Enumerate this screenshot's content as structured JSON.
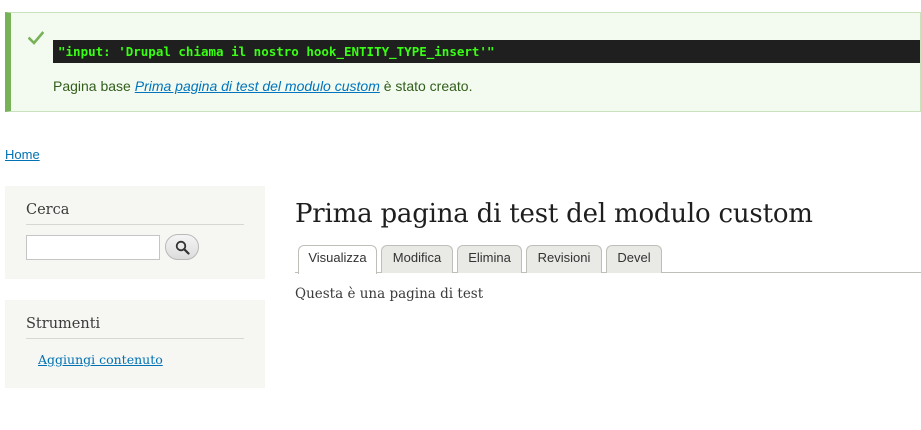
{
  "message": {
    "code_text": "\"input: 'Drupal chiama il nostro hook_ENTITY_TYPE_insert'\"",
    "text_before": "Pagina base ",
    "link_text": "Prima pagina di test del modulo custom",
    "text_after": " è stato creato."
  },
  "breadcrumb": {
    "home": "Home"
  },
  "search_block": {
    "title": "Cerca",
    "input_value": "",
    "button_icon": "search-icon"
  },
  "tools_block": {
    "title": "Strumenti",
    "link": "Aggiungi contenuto"
  },
  "main": {
    "title": "Prima pagina di test del modulo custom",
    "tabs": [
      {
        "label": "Visualizza",
        "active": true
      },
      {
        "label": "Modifica",
        "active": false
      },
      {
        "label": "Elimina",
        "active": false
      },
      {
        "label": "Revisioni",
        "active": false
      },
      {
        "label": "Devel",
        "active": false
      }
    ],
    "body": "Questa è una pagina di test"
  },
  "colors": {
    "status_green": "#77b259",
    "link_blue": "#0071b3"
  }
}
